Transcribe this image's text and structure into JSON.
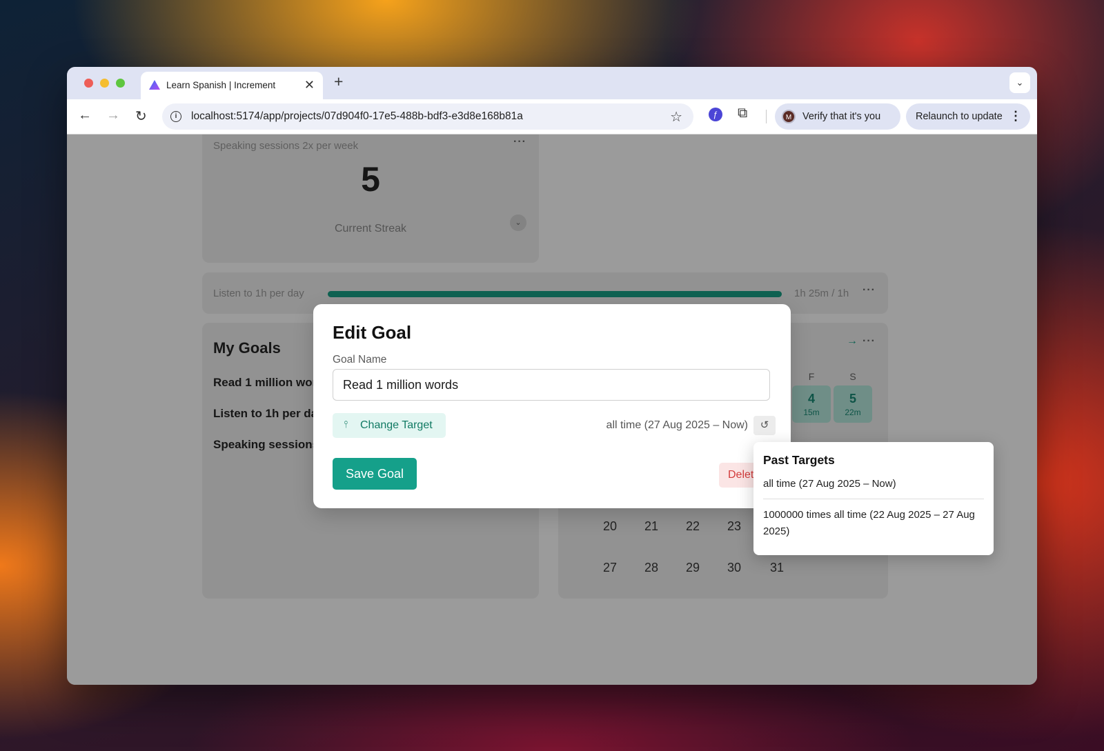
{
  "browser": {
    "tab_title": "Learn Spanish | Increment",
    "new_tab_label": "+",
    "tab_close_label": "✕",
    "tab_menu_label": "⌄",
    "url": "localhost:5174/app/projects/07d904f0-17e5-488b-bdf3-e3d8e168b81a",
    "verify_label": "Verify that it's you",
    "avatar_initial": "M",
    "relaunch_label": "Relaunch to update"
  },
  "streak_card": {
    "title": "Speaking sessions 2x per week",
    "value": "5",
    "label": "Current Streak"
  },
  "listen_card": {
    "label": "Listen to 1h per day",
    "value": "1h 25m / 1h",
    "progress_fraction": 1.0
  },
  "goals_card": {
    "title": "My Goals",
    "items": [
      "Read 1 million words",
      "Listen to 1h per day",
      "Speaking sessions 2x per week"
    ]
  },
  "calendar": {
    "weekday_headers": [
      "F",
      "S"
    ],
    "active_days": [
      {
        "day": "4",
        "sub": "15m"
      },
      {
        "day": "5",
        "sub": "22m"
      }
    ],
    "rows": [
      [
        "20",
        "21",
        "22",
        "23"
      ],
      [
        "27",
        "28",
        "29",
        "30",
        "31"
      ]
    ]
  },
  "modal": {
    "title": "Edit Goal",
    "field_label": "Goal Name",
    "goal_name_value": "Read 1 million words",
    "change_target_label": "Change Target",
    "target_description": "all time (27 Aug 2025 – Now)",
    "save_label": "Save Goal",
    "delete_label": "Delete"
  },
  "popover": {
    "title": "Past Targets",
    "current": "all time (27 Aug 2025 – Now)",
    "past": "1000000 times all time (22 Aug 2025 – 27 Aug 2025)"
  },
  "colors": {
    "accent": "#15a08a",
    "accent_light": "#e3f6f2",
    "danger": "#d33b3b",
    "progress": "#0f6252"
  }
}
